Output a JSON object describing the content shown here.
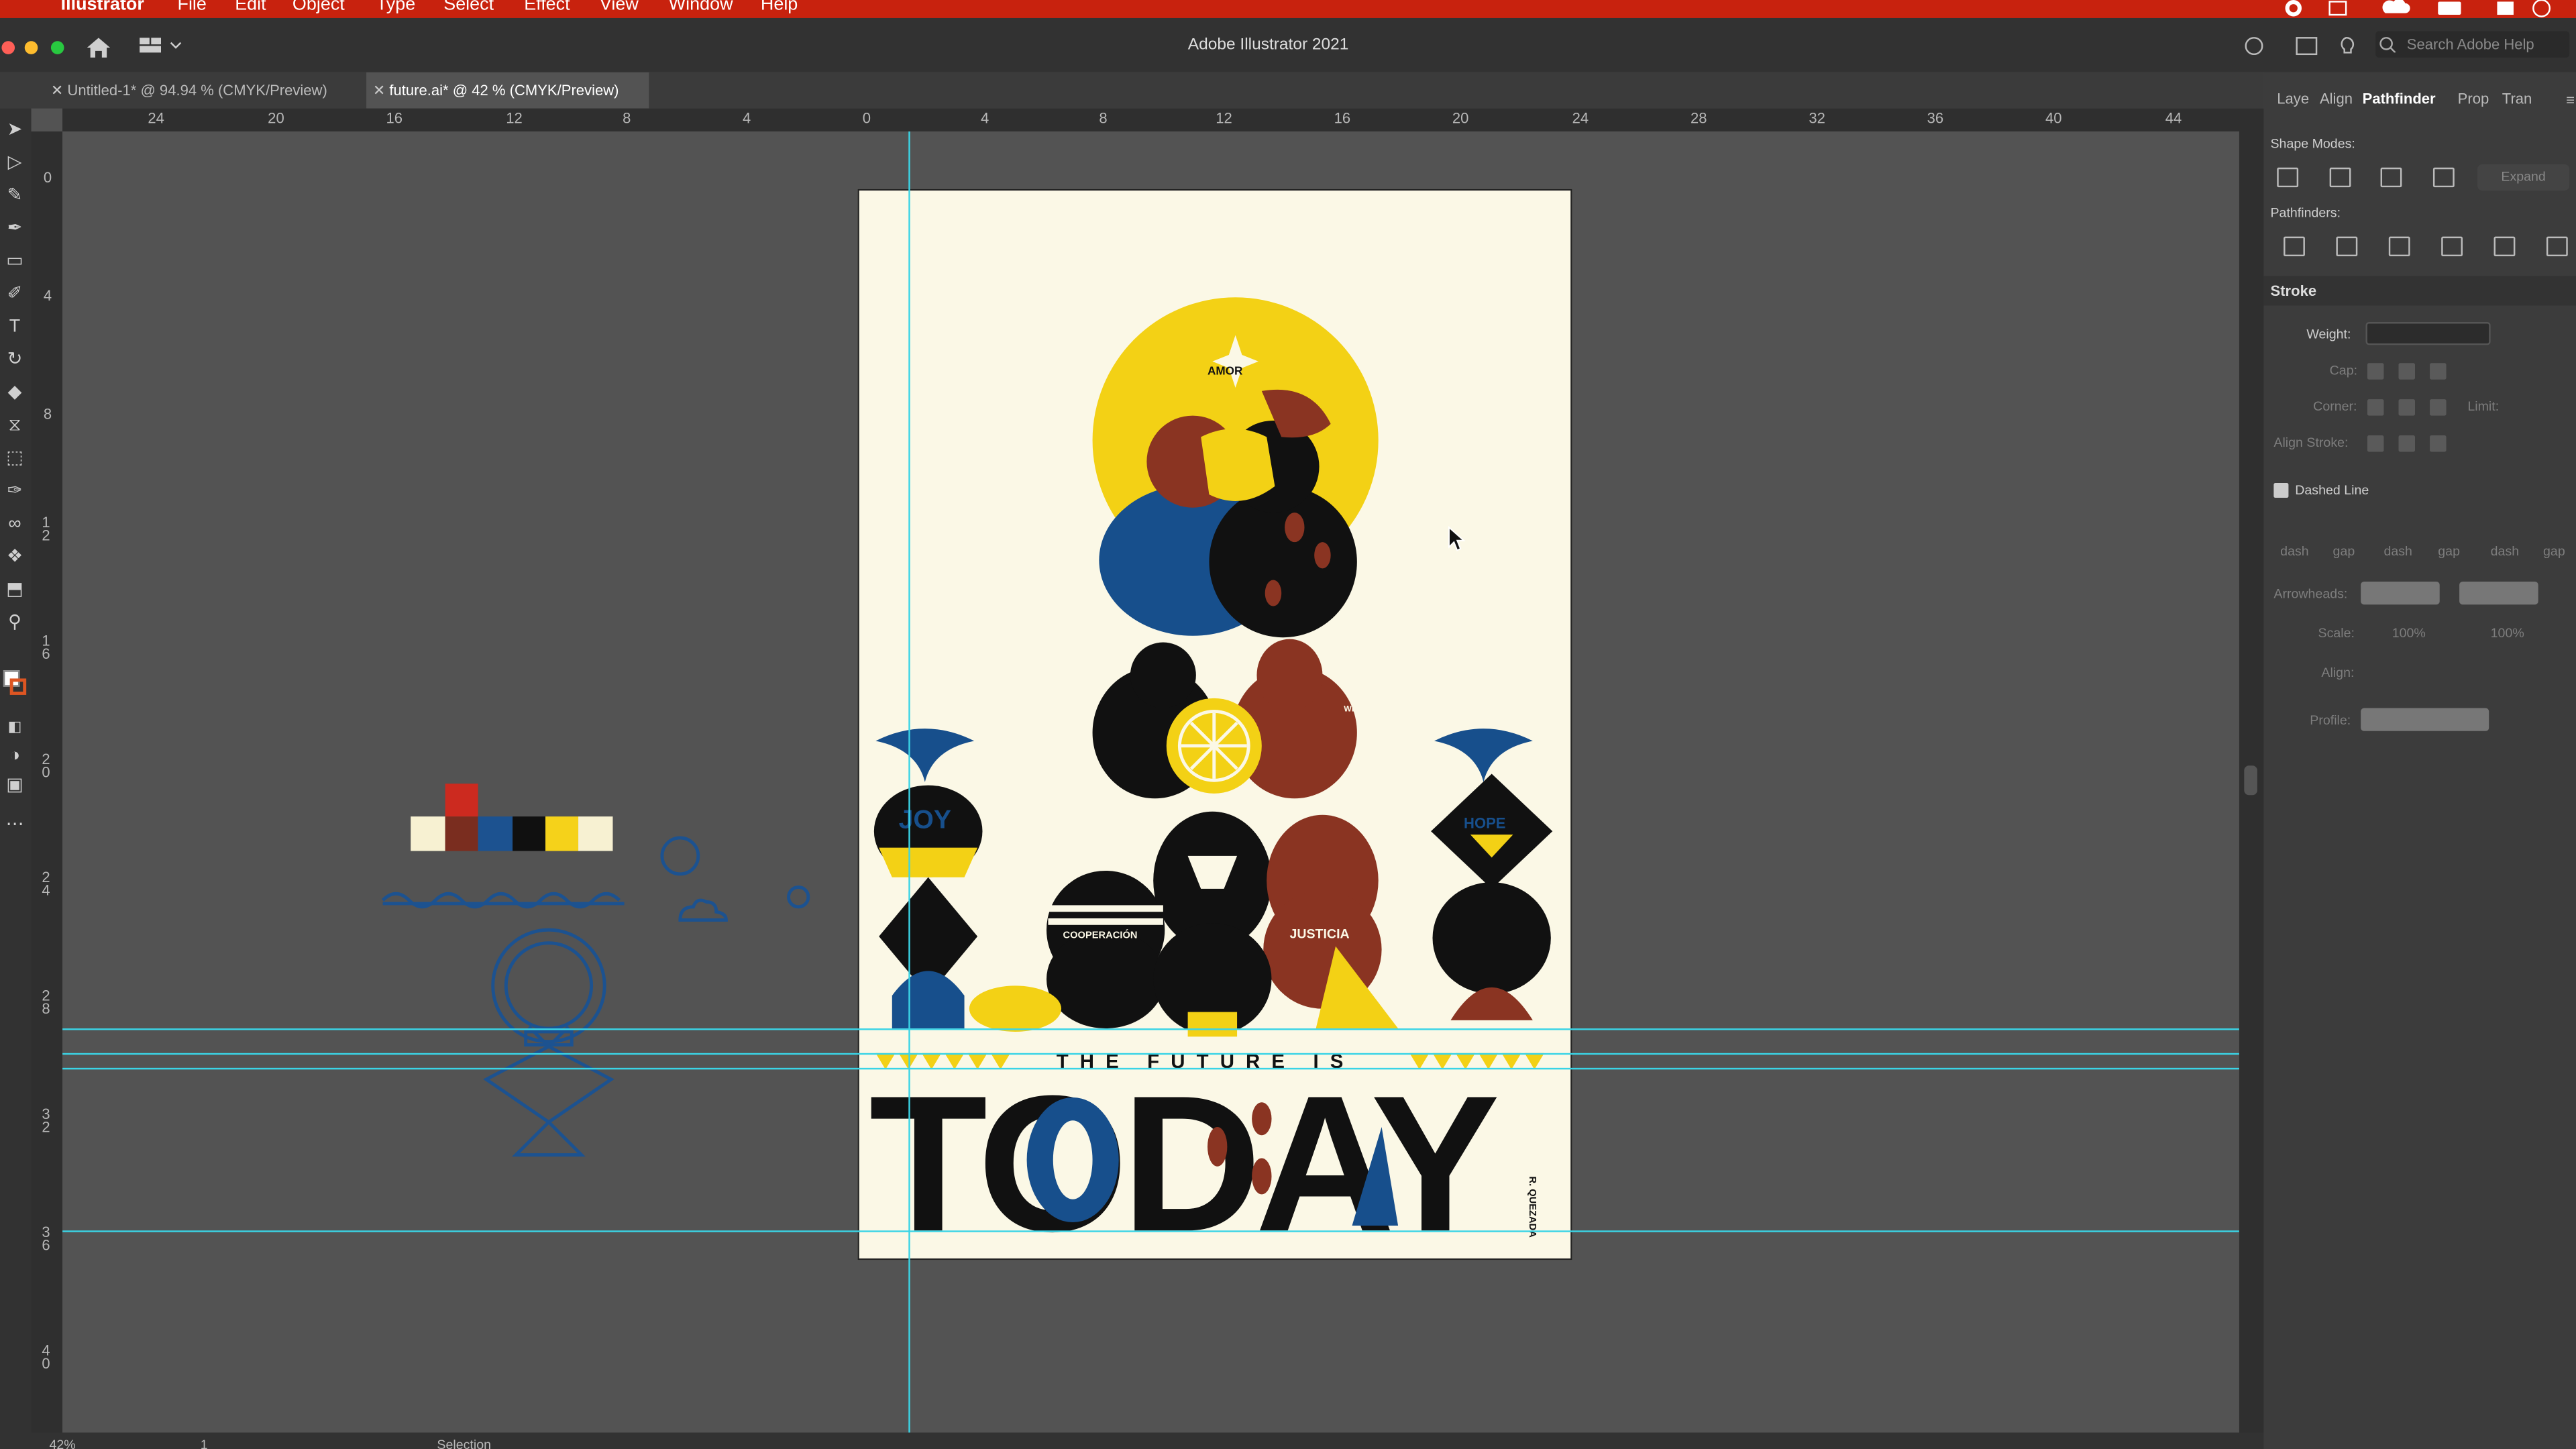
{
  "menubar": {
    "app": "Illustrator",
    "items": [
      "File",
      "Edit",
      "Object",
      "Type",
      "Select",
      "Effect",
      "View",
      "Window",
      "Help"
    ]
  },
  "appbar": {
    "title": "Adobe Illustrator 2021",
    "search_placeholder": "Search Adobe Help"
  },
  "tabs": [
    {
      "label": "Untitled-1* @ 94.94 % (CMYK/Preview)",
      "active": false
    },
    {
      "label": "future.ai* @ 42 % (CMYK/Preview)",
      "active": true
    }
  ],
  "ruler_top": [
    "24",
    "20",
    "16",
    "12",
    "8",
    "4",
    "0",
    "4",
    "8",
    "12",
    "16",
    "20",
    "24",
    "28",
    "32",
    "36",
    "40",
    "44"
  ],
  "ruler_left": [
    "0",
    "4",
    "8",
    "12",
    "16",
    "20",
    "24",
    "28",
    "32",
    "36",
    "40"
  ],
  "artboard": {
    "amor": "AMOR",
    "joy": "JOY",
    "hope": "HOPE",
    "welcome": "WELCOME",
    "cooperacion": "COOPERACIÓN",
    "justicia": "JUSTICIA",
    "tagline": "THE FUTURE IS",
    "headline": "TODAY",
    "signature": "R. QUEZADA"
  },
  "palette_colors": [
    "#f7f1d2",
    "#7a2d1f",
    "#cc2a1f",
    "#1c5290",
    "#101010",
    "#f5d21a",
    "#f7f1d2"
  ],
  "colors": {
    "paper": "#fbf8e6",
    "yellow": "#f3d115",
    "blue": "#174f8c",
    "brown": "#8a3422",
    "black": "#111111",
    "guide": "#3ad4e6",
    "menubar": "#c8220e"
  },
  "panel": {
    "tabs": [
      {
        "label": "Laye",
        "active": false
      },
      {
        "label": "Align",
        "active": false
      },
      {
        "label": "Pathfinder",
        "active": true
      },
      {
        "label": "Prop",
        "active": false
      },
      {
        "label": "Tran",
        "active": false
      }
    ],
    "shape_modes": "Shape Modes:",
    "expand": "Expand",
    "pathfinders": "Pathfinders:",
    "stroke": "Stroke",
    "weight": "Weight:",
    "cap": "Cap:",
    "corner": "Corner:",
    "limit": "Limit:",
    "align_stroke": "Align Stroke:",
    "dashed_line": "Dashed Line",
    "dash_labels": [
      "dash",
      "gap",
      "dash",
      "gap",
      "dash",
      "gap"
    ],
    "arrowheads": "Arrowheads:",
    "scale": "Scale:",
    "scale_value_1": "100%",
    "scale_value_2": "100%",
    "align": "Align:",
    "profile": "Profile:"
  },
  "status": {
    "zoom": "42%",
    "page": "1",
    "tool": "Selection"
  }
}
